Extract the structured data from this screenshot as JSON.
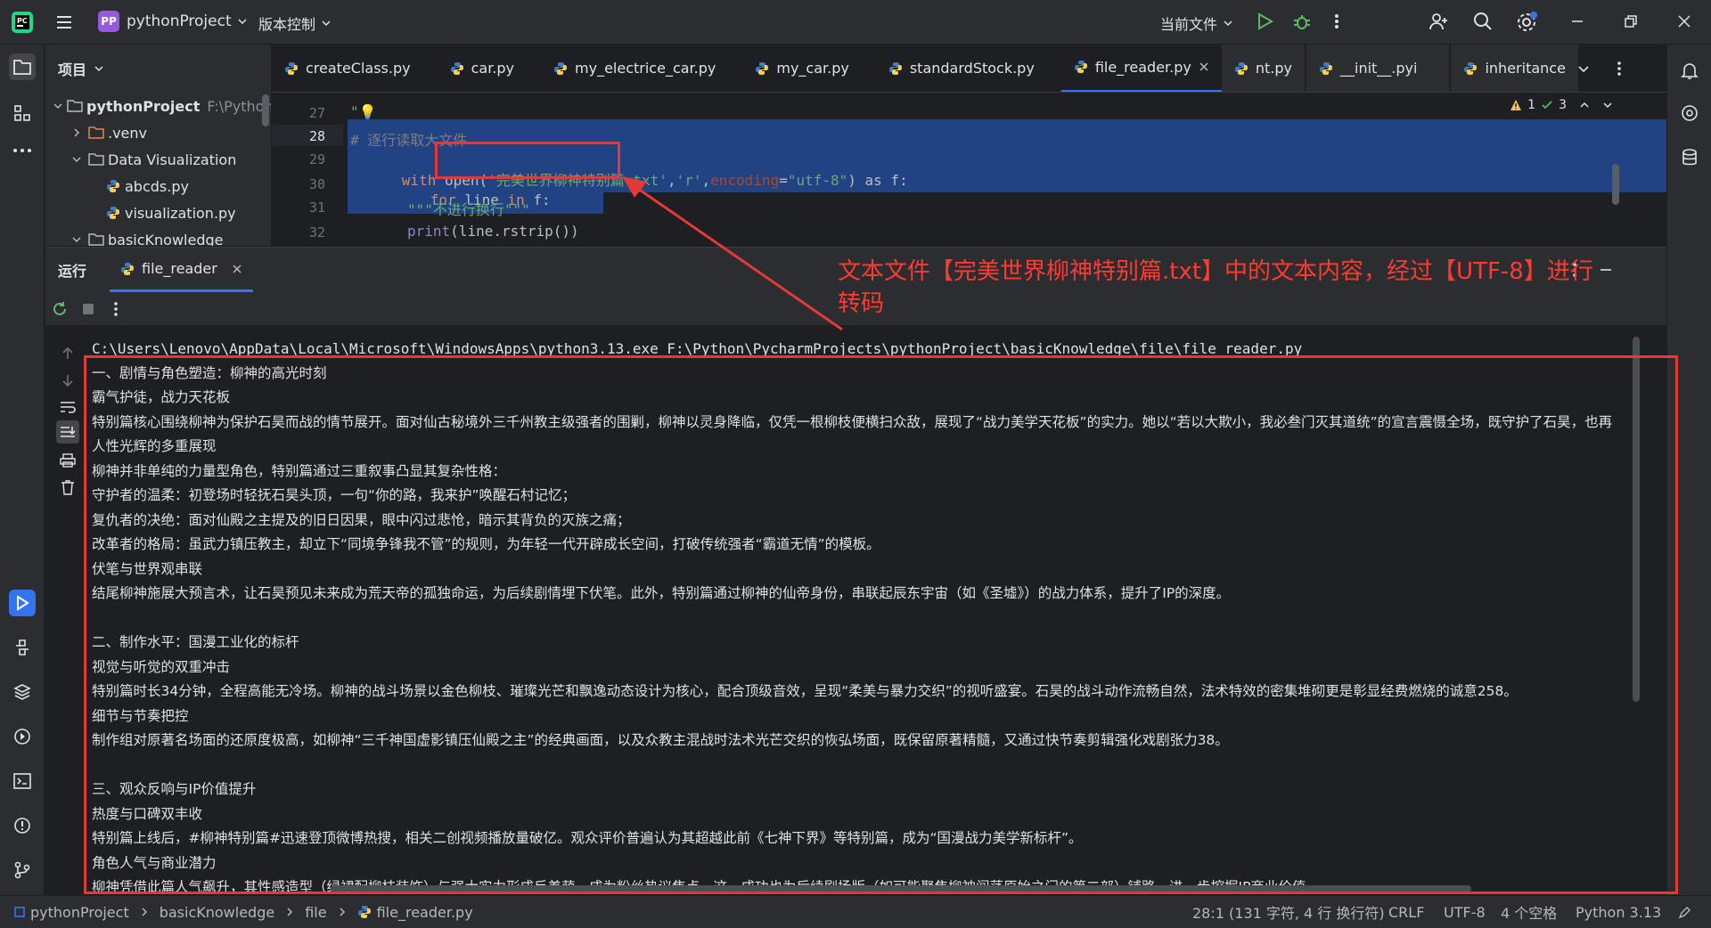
{
  "titlebar": {
    "project_badge": "PP",
    "project_name": "pythonProject",
    "vcs": "版本控制",
    "run_config": "当前文件"
  },
  "project_panel": {
    "title": "项目",
    "tree": [
      {
        "label": "pythonProject",
        "path": "F:\\Python"
      },
      {
        "label": ".venv"
      },
      {
        "label": "Data Visualization"
      },
      {
        "label": "abcds.py"
      },
      {
        "label": "visualization.py"
      },
      {
        "label": "basicKnowledge"
      }
    ]
  },
  "editor": {
    "tabs": [
      {
        "label": "createClass.py"
      },
      {
        "label": "car.py"
      },
      {
        "label": "my_electrice_car.py"
      },
      {
        "label": "my_car.py"
      },
      {
        "label": "standardStock.py"
      },
      {
        "label": "file_reader.py",
        "active": true
      },
      {
        "label": "nt.py"
      },
      {
        "label": "__init__.pyi"
      },
      {
        "label": "inheritance"
      }
    ],
    "inspections": {
      "warnings": "1",
      "checks": "3"
    },
    "lines": [
      {
        "num": "27",
        "text": "\"💡"
      },
      {
        "num": "28",
        "comment": "# 逐行读取大文件"
      },
      {
        "num": "29",
        "kw": "with",
        "fn": " open(",
        "str1": "'完美世界柳神特别篇.txt'",
        "sep": ",",
        "str2": "'r'",
        "sep2": ",",
        "param": "encoding",
        "eq": "=",
        "str3": "\"utf-8\"",
        "tail": ") as f:"
      },
      {
        "num": "30",
        "kw": "for",
        "rest": " line ",
        "kw2": "in",
        "rest2": " f:"
      },
      {
        "num": "31",
        "str": "\"\"\"不进行换行\"\"\""
      },
      {
        "num": "32",
        "fn": "print",
        "rest": "(line.rstrip())"
      }
    ]
  },
  "run_panel": {
    "title": "运行",
    "tab": "file_reader",
    "output": [
      "C:\\Users\\Lenovo\\AppData\\Local\\Microsoft\\WindowsApps\\python3.13.exe F:\\Python\\PycharmProjects\\pythonProject\\basicKnowledge\\file\\file_reader.py",
      "一、剧情与角色塑造：柳神的高光时刻",
      "霸气护徒，战力天花板",
      "特别篇核心围绕柳神为保护石昊而战的情节展开。面对仙古秘境外三千州教主级强者的围剿，柳神以灵身降临，仅凭一根柳枝便横扫众敌，展现了“战力美学天花板”的实力。她以“若以大欺小，我必叁门灭其道统”的宣言震慑全场，既守护了石昊，也再",
      "人性光辉的多重展现",
      "柳神并非单纯的力量型角色，特别篇通过三重叙事凸显其复杂性格：",
      "守护者的温柔：初登场时轻抚石昊头顶，一句“你的路，我来护”唤醒石村记忆；",
      "复仇者的决绝：面对仙殿之主提及的旧日因果，眼中闪过悲怆，暗示其背负的灭族之痛；",
      "改革者的格局：虽武力镇压教主，却立下“同境争锋我不管”的规则，为年轻一代开辟成长空间，打破传统强者“霸道无情”的模板。",
      "伏笔与世界观串联",
      "结尾柳神施展大预言术，让石昊预见未来成为荒天帝的孤独命运，为后续剧情埋下伏笔。此外，特别篇通过柳神的仙帝身份，串联起辰东宇宙（如《圣墟》）的战力体系，提升了IP的深度。",
      "",
      "二、制作水平：国漫工业化的标杆",
      "视觉与听觉的双重冲击",
      "特别篇时长34分钟，全程高能无冷场。柳神的战斗场景以金色柳枝、璀璨光芒和飘逸动态设计为核心，配合顶级音效，呈现“柔美与暴力交织”的视听盛宴。石昊的战斗动作流畅自然，法术特效的密集堆砌更是彰显经费燃烧的诚意258。",
      "细节与节奏把控",
      "制作组对原著名场面的还原度极高，如柳神“三千神国虚影镇压仙殿之主”的经典画面，以及众教主混战时法术光芒交织的恢弘场面，既保留原著精髓，又通过快节奏剪辑强化戏剧张力38。",
      "",
      "三、观众反响与IP价值提升",
      "热度与口碑双丰收",
      "特别篇上线后，#柳神特别篇#迅速登顶微博热搜，相关二创视频播放量破亿。观众评价普遍认为其超越此前《七神下界》等特别篇，成为“国漫战力美学新标杆”。",
      "角色人气与商业潜力",
      "柳神凭借此篇人气飙升，其性感造型（绿裙配柳枝装饰）与强大实力形成反差萌，成为粉丝热议焦点。这一成功也为后续剧场版（如可能聚焦柳神闯荡原始之门的第二部）铺路，进一步挖掘IP商业价值。"
    ]
  },
  "annotation": {
    "text": "文本文件【完美世界柳神特别篇.txt】中的文本内容，经过【UTF-8】进行转码"
  },
  "statusbar": {
    "crumbs": [
      "pythonProject",
      "basicKnowledge",
      "file",
      "file_reader.py"
    ],
    "position": "28:1 (131 字符, 4 行 换行符)",
    "line_sep": "CRLF",
    "encoding": "UTF-8",
    "indent": "4 个空格",
    "interpreter": "Python 3.13"
  },
  "colors": {
    "accent": "#3574f0",
    "selection": "#214283",
    "annotation": "#e53935",
    "string": "#6aab73",
    "keyword": "#cf8e6d",
    "comment": "#7a7e85",
    "param": "#aa4926"
  }
}
